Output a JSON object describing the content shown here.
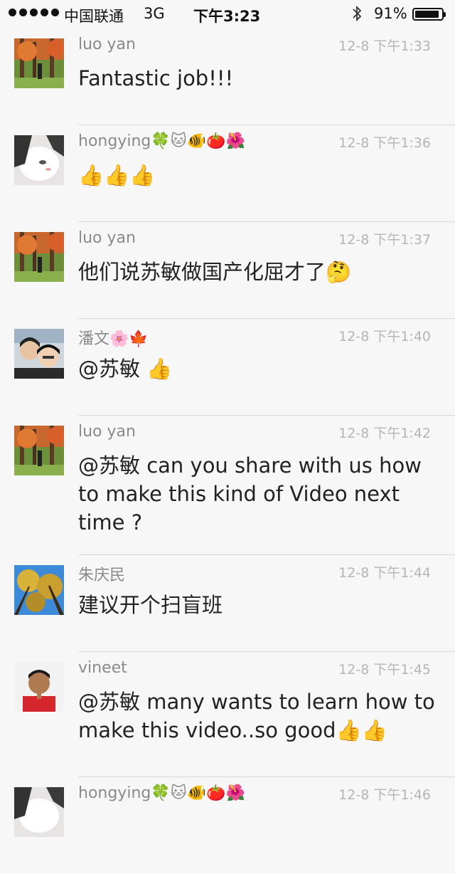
{
  "status_bar": {
    "carrier": "中国联通",
    "network": "3G",
    "time": "下午3:23",
    "battery_percent_label": "91%",
    "battery_level": 0.91
  },
  "comments": [
    {
      "name": "luo yan",
      "time": "12-8 下午1:33",
      "text": "Fantastic job!!!",
      "avatar": "forest-photo"
    },
    {
      "name": "hongying🍀🐱🐠🍅🌺",
      "time": "12-8 下午1:36",
      "text": "👍👍👍",
      "avatar": "cat-photo"
    },
    {
      "name": "luo yan",
      "time": "12-8 下午1:37",
      "text": "他们说苏敏做国产化屈才了🤔",
      "avatar": "forest-photo"
    },
    {
      "name": "潘文🌸🍁",
      "time": "12-8 下午1:40",
      "text": "@苏敏 👍",
      "avatar": "couple-photo"
    },
    {
      "name": "luo yan",
      "time": "12-8 下午1:42",
      "text": "@苏敏 can you share with us how to make this kind of Video next time ?",
      "avatar": "forest-photo"
    },
    {
      "name": "朱庆民",
      "time": "12-8 下午1:44",
      "text": "建议开个扫盲班",
      "avatar": "tree-photo"
    },
    {
      "name": "vineet",
      "time": "12-8 下午1:45",
      "text": "@苏敏 many wants to learn how to make this video..so good👍👍",
      "avatar": "man-photo"
    },
    {
      "name": "hongying🍀🐱🐠🍅🌺",
      "time": "12-8 下午1:46",
      "text": "",
      "avatar": "cat-photo"
    }
  ]
}
